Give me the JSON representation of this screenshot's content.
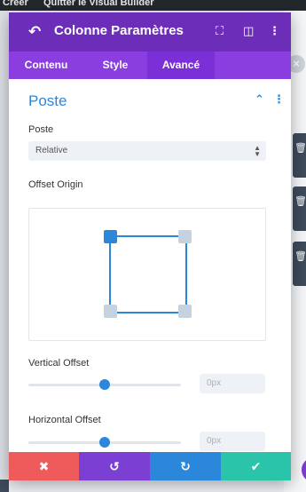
{
  "topbar": {
    "create_label": "Créer",
    "quit_label": "Quitter le Visual Builder"
  },
  "modal": {
    "title": "Colonne Paramètres",
    "tabs": [
      {
        "label": "Contenu",
        "active": false
      },
      {
        "label": "Style",
        "active": false
      },
      {
        "label": "Avancé",
        "active": true
      }
    ],
    "section": {
      "title": "Poste",
      "position": {
        "label": "Poste",
        "selected": "Relative"
      },
      "offset_origin": {
        "label": "Offset Origin",
        "selected_corner": "top-left"
      },
      "vertical_offset": {
        "label": "Vertical Offset",
        "value": "0px",
        "slider_fraction": 0.5
      },
      "horizontal_offset": {
        "label": "Horizontal Offset",
        "value": "0px",
        "slider_fraction": 0.5
      }
    },
    "footer": {
      "cancel_icon": "close-icon",
      "undo_icon": "undo-icon",
      "redo_icon": "redo-icon",
      "save_icon": "check-icon"
    }
  },
  "colors": {
    "header": "#6c2eb9",
    "tabs": "#8a3ee0",
    "accent": "#2b87da",
    "cancel": "#ef5a5a",
    "undo": "#7b3fd4",
    "redo": "#2b87da",
    "save": "#29c4a9"
  }
}
